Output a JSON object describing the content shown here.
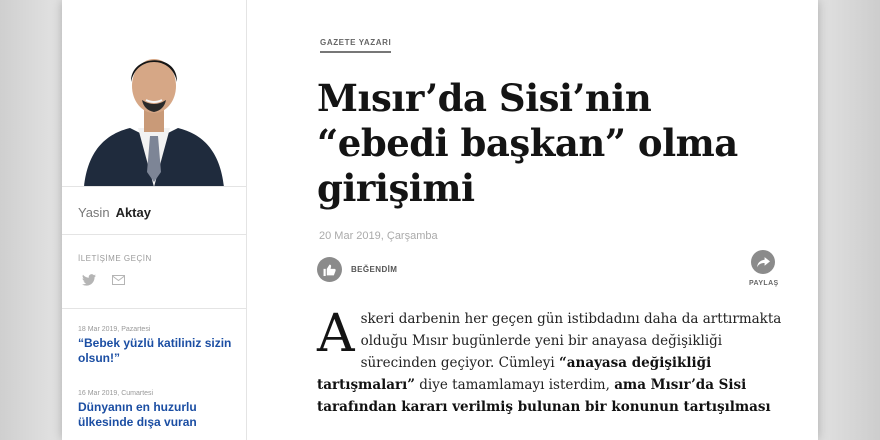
{
  "sidebar": {
    "author": {
      "first_name": "Yasin",
      "last_name": "Aktay"
    },
    "contact_title": "İLETİŞİME GEÇİN",
    "icons": [
      "twitter-icon",
      "mail-icon"
    ],
    "articles": [
      {
        "date": "18 Mar 2019, Pazartesi",
        "title": "“Bebek yüzlü katiliniz sizin olsun!”"
      },
      {
        "date": "16 Mar 2019, Cumartesi",
        "title": "Dünyanın en huzurlu ülkesinde dışa vuran"
      }
    ]
  },
  "article": {
    "category": "GAZETE YAZARI",
    "headline": "Mısır’da Sisi’nin “ebedi başkan” olma girişimi",
    "date": "20 Mar 2019, Çarşamba",
    "like_label": "BEĞENDİM",
    "share_label": "PAYLAŞ",
    "drop_cap": "A",
    "body": {
      "s1": "skeri darbenin her geçen gün istibdadını daha da arttırmakta olduğu Mısır bugünlerde yeni bir anayasa değişikliği sürecinden geçiyor. Cümleyi ",
      "b1": "“anayasa değişikliği tartışmaları”",
      "s2": " diye tamamlamayı isterdim, ",
      "b2": "ama Mısır’da Sisi tarafından kararı verilmiş bulunan bir konunun tartışılması"
    }
  },
  "colors": {
    "link": "#1b4ea3",
    "muted": "#aaaaaa",
    "icon_bg": "#8b8b8b"
  }
}
